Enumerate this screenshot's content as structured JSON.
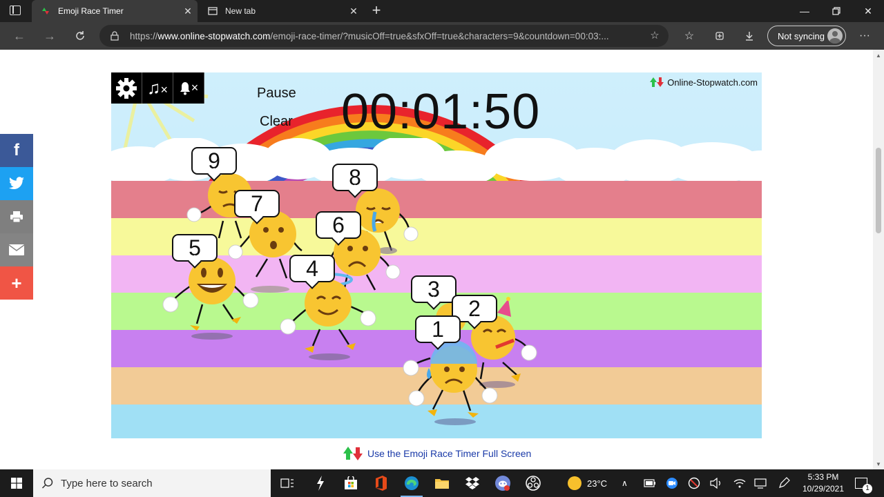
{
  "browser": {
    "tabs": [
      {
        "title": "Emoji Race Timer",
        "active": true
      },
      {
        "title": "New tab",
        "active": false
      }
    ],
    "url_prefix": "https://",
    "url_domain": "www.online-stopwatch.com",
    "url_rest": "/emoji-race-timer/?musicOff=true&sfxOff=true&characters=9&countdown=00:03:...",
    "sync_label": "Not syncing"
  },
  "share": {
    "items": [
      {
        "name": "facebook",
        "glyph": "f",
        "color": "#3b5998"
      },
      {
        "name": "twitter",
        "glyph": "",
        "color": "#1da1f2"
      },
      {
        "name": "print",
        "glyph": "",
        "color": "#7f7f7f"
      },
      {
        "name": "email",
        "glyph": "",
        "color": "#848484"
      },
      {
        "name": "more",
        "glyph": "+",
        "color": "#f05545"
      }
    ]
  },
  "game": {
    "pause_label": "Pause",
    "clear_label": "Clear",
    "timer": "00:01:50",
    "brand": "Online-Stopwatch.com",
    "lane_colors": [
      "#e47f8c",
      "#f7f99a",
      "#f2b5f3",
      "#b9f98f",
      "#c880f0",
      "#f2cb96",
      "#a0e0f5"
    ],
    "racers": [
      "1",
      "2",
      "3",
      "4",
      "5",
      "6",
      "7",
      "8",
      "9"
    ]
  },
  "footer_link": "Use the Emoji Race Timer Full Screen",
  "taskbar": {
    "search_placeholder": "Type here to search",
    "weather": "23°C",
    "time": "5:33 PM",
    "date": "10/29/2021",
    "notification_count": "1"
  }
}
